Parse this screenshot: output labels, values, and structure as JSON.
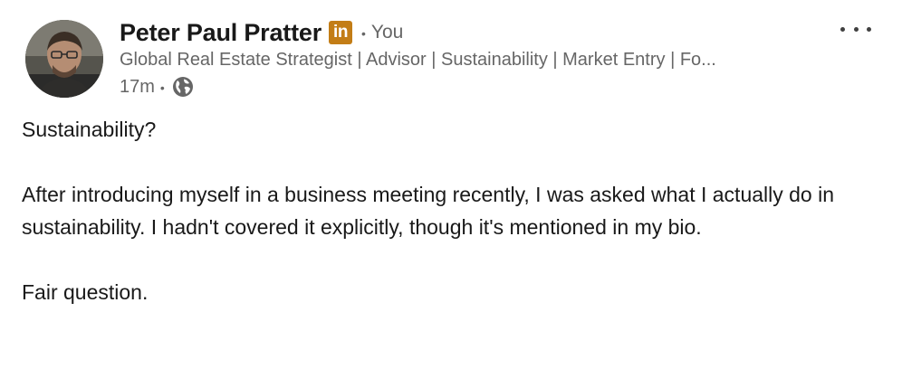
{
  "post": {
    "author": {
      "name": "Peter Paul Pratter",
      "badge": "in",
      "separator": "•",
      "relation": "You",
      "headline": "Global Real Estate Strategist | Advisor | Sustainability | Market Entry | Fo..."
    },
    "meta": {
      "time": "17m",
      "separator": "•",
      "visibility_icon": "globe-icon"
    },
    "paragraphs": [
      "Sustainability?",
      "After introducing myself in a business meeting recently, I was asked what I actually do in sustainability. I hadn't covered it explicitly, though it's mentioned in my bio.",
      "Fair question."
    ],
    "more_icon": "more-options-icon"
  },
  "colors": {
    "name_text": "#191919",
    "secondary_text": "#666666",
    "premium_badge": "#c37d16",
    "background": "#ffffff"
  }
}
